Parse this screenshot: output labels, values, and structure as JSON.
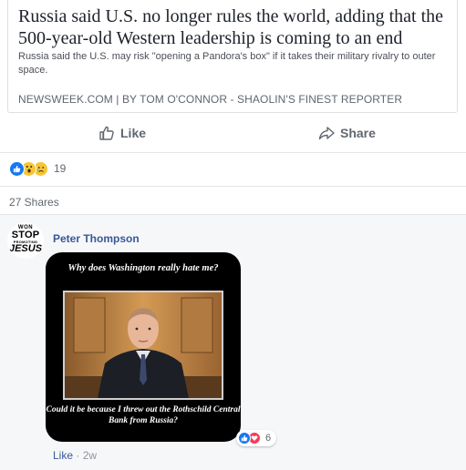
{
  "link_card": {
    "title": "Russia said U.S. no longer rules the world, adding that the 500-year-old Western leadership is coming to an end",
    "description": "Russia said the U.S. may risk \"opening a Pandora's box\" if it takes their military rivalry to outer space.",
    "source": "NEWSWEEK.COM | BY TOM O'CONNOR - SHAOLIN'S FINEST REPORTER"
  },
  "actions": {
    "like_label": "Like",
    "share_label": "Share"
  },
  "reactions": {
    "count": "19",
    "icons": [
      "like-icon",
      "wow-icon",
      "sad-icon"
    ]
  },
  "shares": {
    "label": "27 Shares"
  },
  "comment": {
    "author": "Peter Thompson",
    "avatar_lines": [
      "WON",
      "STOP",
      "PROMOTING",
      "JESUS"
    ],
    "meme": {
      "top_text": "Why does Washington really hate me?",
      "bottom_text": "Could it be because I threw out the Rothschild Central Bank from Russia?"
    },
    "reactions_count": "6",
    "like_link": "Like",
    "separator": "·",
    "time": "2w"
  },
  "colors": {
    "link_blue": "#385898",
    "like_blue": "#1877f2",
    "love_red": "#f33e58",
    "wow_yellow": "#f7c534",
    "muted_gray": "#606770"
  }
}
